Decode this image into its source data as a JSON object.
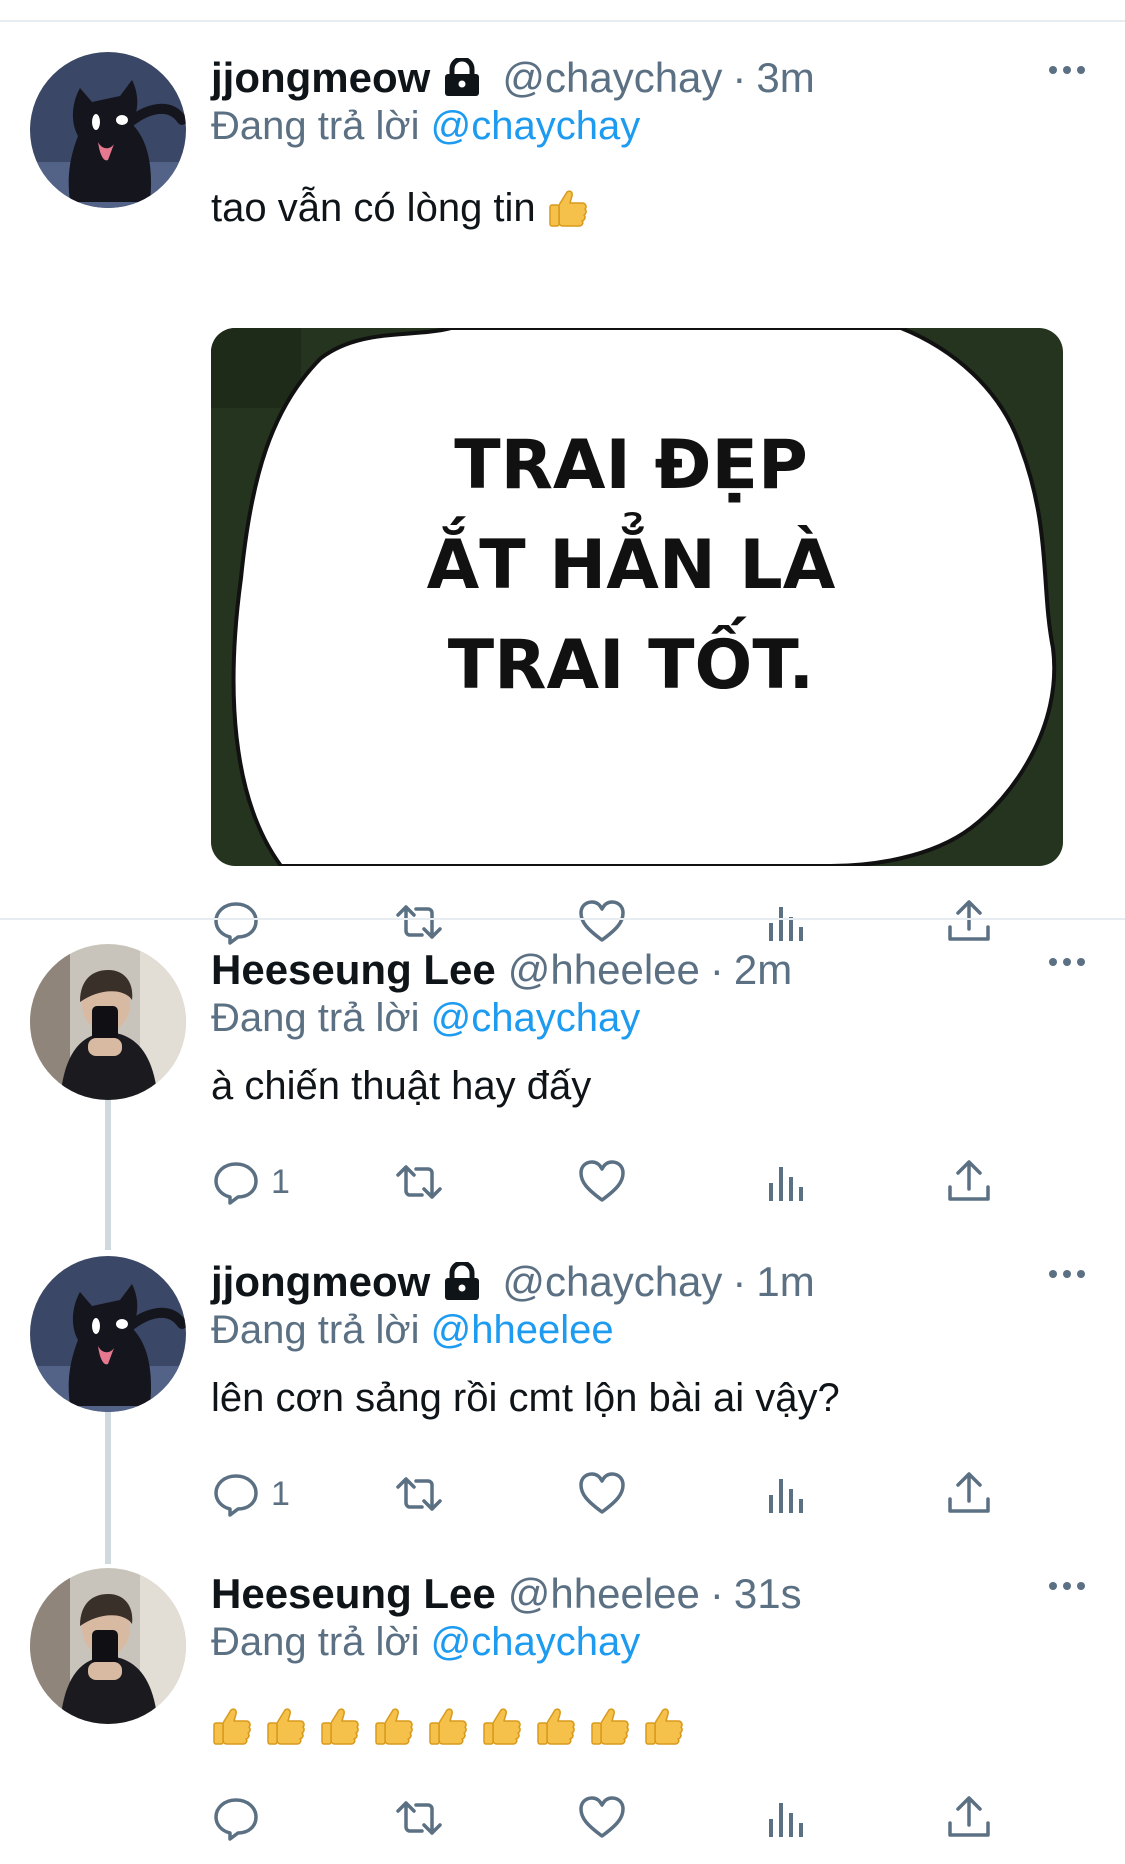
{
  "colors": {
    "link": "#1d9bf0",
    "secondary": "#5b7083",
    "divider": "#e6ecf0",
    "thread": "#cfd9de"
  },
  "tweets": [
    {
      "name": "jjongmeow",
      "protected": true,
      "handle": "@chaychay",
      "separator": "·",
      "time": "3m",
      "reply_prefix": "Đang trả lời",
      "reply_to": "@chaychay",
      "text": "tao vẫn có lòng tin",
      "emoji": "thumbs-up",
      "media_text": [
        "TRAI ĐẸP",
        "ẮT HẲN LÀ",
        "TRAI TỐT."
      ],
      "reply_count": ""
    },
    {
      "name": "Heeseung Lee",
      "protected": false,
      "handle": "@hheelee",
      "separator": "·",
      "time": "2m",
      "reply_prefix": "Đang trả lời",
      "reply_to": "@chaychay",
      "text": "à chiến thuật hay đấy",
      "reply_count": "1"
    },
    {
      "name": "jjongmeow",
      "protected": true,
      "handle": "@chaychay",
      "separator": "·",
      "time": "1m",
      "reply_prefix": "Đang trả lời",
      "reply_to": "@hheelee",
      "text": "lên cơn sảng rồi cmt lộn bài ai vậy?",
      "reply_count": "1"
    },
    {
      "name": "Heeseung Lee",
      "protected": false,
      "handle": "@hheelee",
      "separator": "·",
      "time": "31s",
      "reply_prefix": "Đang trả lời",
      "reply_to": "@chaychay",
      "emoji_count": 9,
      "emoji": "thumbs-up",
      "reply_count": ""
    }
  ],
  "icons": {
    "more": "more-icon",
    "reply": "reply-icon",
    "retweet": "retweet-icon",
    "like": "like-icon",
    "analytics": "analytics-icon",
    "share": "share-icon",
    "lock": "lock-icon"
  }
}
